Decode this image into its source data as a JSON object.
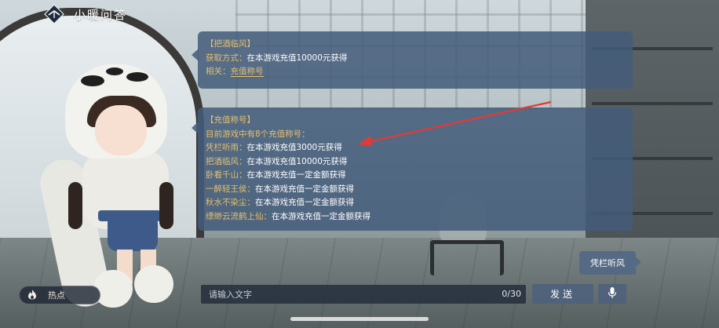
{
  "header": {
    "title": "小暖问答",
    "logo_icon": "diamond-arrow-logo"
  },
  "bubble1": {
    "heading": "【把酒临风】",
    "method_label": "获取方式：",
    "method_value": "在本游戏充值10000元获得",
    "related_label": "相关：",
    "related_link": "充值称号"
  },
  "bubble2": {
    "heading": "【充值称号】",
    "intro": "目前游戏中有8个充值称号：",
    "items": [
      {
        "name": "凭栏听雨：",
        "value": "在本游戏充值3000元获得"
      },
      {
        "name": "把酒临风：",
        "value": "在本游戏充值10000元获得"
      },
      {
        "name": "卧看千山：",
        "value": "在本游戏充值一定金额获得"
      },
      {
        "name": "一醉轻王侯：",
        "value": "在本游戏充值一定金额获得"
      },
      {
        "name": "秋水不染尘：",
        "value": "在本游戏充值一定金额获得"
      },
      {
        "name": "缥缈云流鹤上仙：",
        "value": "在本游戏充值一定金额获得"
      }
    ]
  },
  "quick_reply": {
    "label": "凭栏听风"
  },
  "bottom": {
    "hot_label": "热点",
    "hot_icon": "flame-icon",
    "input_placeholder": "请输入文字",
    "counter": "0/30",
    "send_label": "发送",
    "mic_icon": "microphone-icon"
  },
  "colors": {
    "accent_gold": "#e8bf6a",
    "bubble_bg": "#445c7a",
    "annotation_red": "#e53935"
  }
}
